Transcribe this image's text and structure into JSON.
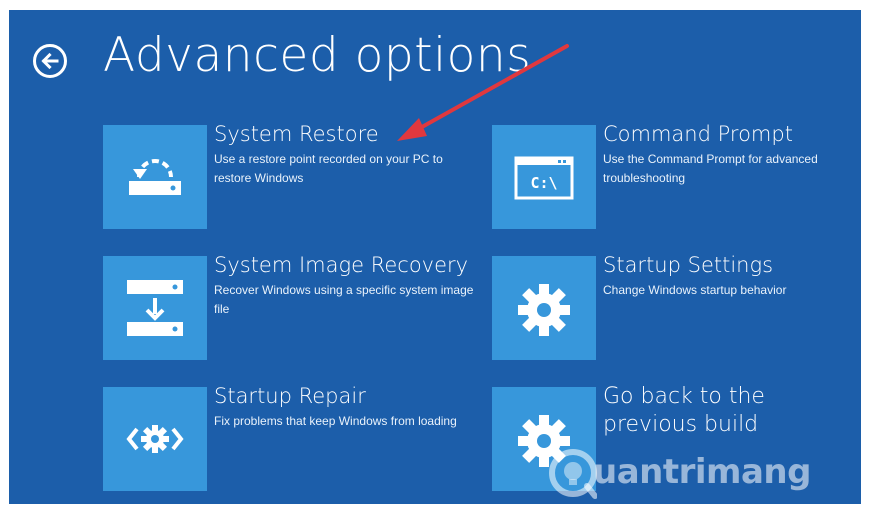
{
  "header": {
    "title": "Advanced options",
    "back_icon": "back-arrow-icon"
  },
  "options": [
    {
      "title": "System Restore",
      "description": "Use a restore point recorded on your PC to restore Windows",
      "icon": "system-restore-icon"
    },
    {
      "title": "Command Prompt",
      "description": "Use the Command Prompt for advanced troubleshooting",
      "icon": "command-prompt-icon",
      "icon_text": "C:\\"
    },
    {
      "title": "System Image Recovery",
      "description": "Recover Windows using a specific system image file",
      "icon": "system-image-recovery-icon"
    },
    {
      "title": "Startup Settings",
      "description": "Change Windows startup behavior",
      "icon": "gear-icon"
    },
    {
      "title": "Startup Repair",
      "description": "Fix problems that keep Windows from loading",
      "icon": "startup-repair-icon"
    },
    {
      "title": "Go back to the previous build",
      "description": "",
      "icon": "gear-icon"
    }
  ],
  "watermark": {
    "text": "uantrimang",
    "icon": "lightbulb-logo-icon"
  },
  "colors": {
    "background": "#1c5eaa",
    "tile": "#3797db",
    "arrow": "#e0383e"
  }
}
